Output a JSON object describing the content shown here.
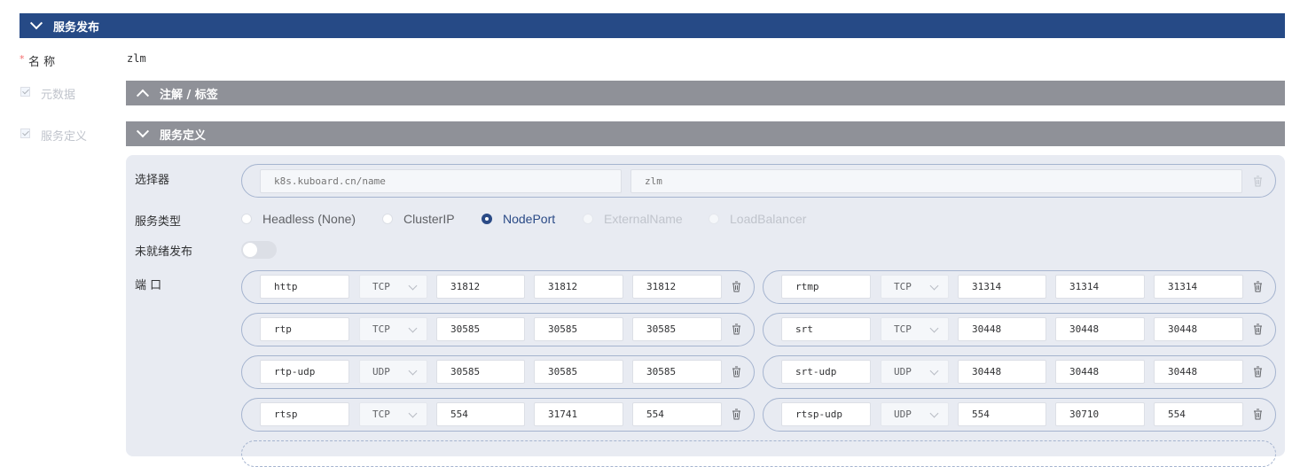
{
  "section": {
    "title": "服务发布"
  },
  "form": {
    "name_required": "*",
    "name_label": "名 称",
    "name_value": "zlm",
    "metadata_label": "元数据",
    "service_def_label": "服务定义"
  },
  "annotations_bar": {
    "title": "注解 / 标签"
  },
  "service_bar": {
    "title": "服务定义"
  },
  "selector": {
    "label": "选择器",
    "key_placeholder": "k8s.kuboard.cn/name",
    "value_placeholder": "zlm"
  },
  "service_type": {
    "label": "服务类型",
    "options": [
      {
        "label": "Headless (None)",
        "state": "unchecked"
      },
      {
        "label": "ClusterIP",
        "state": "unchecked"
      },
      {
        "label": "NodePort",
        "state": "checked"
      },
      {
        "label": "ExternalName",
        "state": "disabled"
      },
      {
        "label": "LoadBalancer",
        "state": "disabled"
      }
    ]
  },
  "unready": {
    "label": "未就绪发布",
    "enabled": false
  },
  "ports": {
    "label": "端 口",
    "rows": [
      [
        {
          "name": "http",
          "protocol": "TCP",
          "port": "31812",
          "target": "31812",
          "node_port": "31812"
        },
        {
          "name": "rtmp",
          "protocol": "TCP",
          "port": "31314",
          "target": "31314",
          "node_port": "31314"
        }
      ],
      [
        {
          "name": "rtp",
          "protocol": "TCP",
          "port": "30585",
          "target": "30585",
          "node_port": "30585"
        },
        {
          "name": "srt",
          "protocol": "TCP",
          "port": "30448",
          "target": "30448",
          "node_port": "30448"
        }
      ],
      [
        {
          "name": "rtp-udp",
          "protocol": "UDP",
          "port": "30585",
          "target": "30585",
          "node_port": "30585"
        },
        {
          "name": "srt-udp",
          "protocol": "UDP",
          "port": "30448",
          "target": "30448",
          "node_port": "30448"
        }
      ],
      [
        {
          "name": "rtsp",
          "protocol": "TCP",
          "port": "554",
          "target": "31741",
          "node_port": "554"
        },
        {
          "name": "rtsp-udp",
          "protocol": "UDP",
          "port": "554",
          "target": "30710",
          "node_port": "554"
        }
      ]
    ]
  },
  "icons": {
    "trash": "trash-icon",
    "collapse": "chevron-down-icon",
    "expand": "chevron-up-icon"
  },
  "colors": {
    "header": "#264a86",
    "subheader": "#8f9198",
    "panel": "#e8ebf2",
    "radio_active": "#2a4a86"
  }
}
